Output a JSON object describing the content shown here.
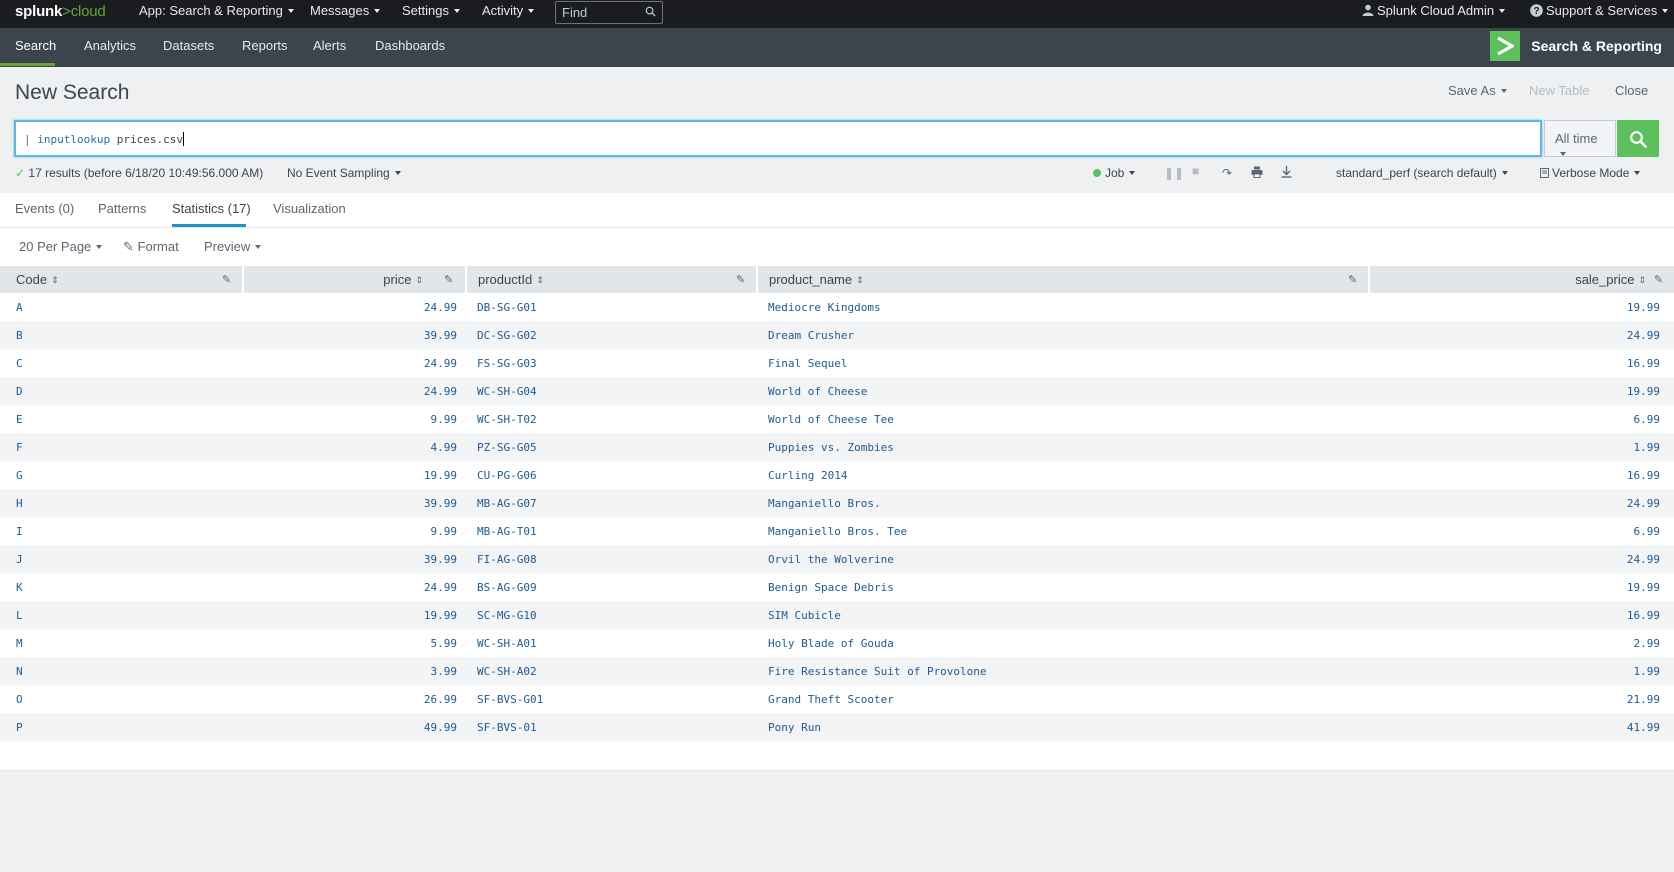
{
  "topbar": {
    "logo_main": "splunk",
    "logo_gt": ">",
    "logo_cloud": "cloud",
    "menus": [
      "App: Search & Reporting",
      "Messages",
      "Settings",
      "Activity"
    ],
    "find_placeholder": "Find",
    "user": "Splunk Cloud Admin",
    "support": "Support & Services"
  },
  "nav": {
    "items": [
      "Search",
      "Analytics",
      "Datasets",
      "Reports",
      "Alerts",
      "Dashboards"
    ],
    "active": "Search",
    "app_title": "Search & Reporting"
  },
  "page": {
    "title": "New Search",
    "save_as": "Save As",
    "new_table": "New Table",
    "close": "Close"
  },
  "search": {
    "pipe": "|",
    "command": "inputlookup",
    "argument": "prices.csv",
    "time_range": "All time"
  },
  "status": {
    "results": "17 results (before 6/18/20 10:49:56.000 AM)",
    "sampling": "No Event Sampling",
    "job": "Job",
    "perf": "standard_perf (search default)",
    "mode": "Verbose Mode"
  },
  "tabs": [
    "Events (0)",
    "Patterns",
    "Statistics (17)",
    "Visualization"
  ],
  "active_tab": "Statistics (17)",
  "toolbar": {
    "per_page": "20 Per Page",
    "format": "Format",
    "preview": "Preview"
  },
  "table": {
    "columns": [
      "Code",
      "price",
      "productId",
      "product_name",
      "sale_price"
    ],
    "rows": [
      [
        "A",
        "24.99",
        "DB-SG-G01",
        "Mediocre Kingdoms",
        "19.99"
      ],
      [
        "B",
        "39.99",
        "DC-SG-G02",
        "Dream Crusher",
        "24.99"
      ],
      [
        "C",
        "24.99",
        "FS-SG-G03",
        "Final Sequel",
        "16.99"
      ],
      [
        "D",
        "24.99",
        "WC-SH-G04",
        "World of Cheese",
        "19.99"
      ],
      [
        "E",
        "9.99",
        "WC-SH-T02",
        "World of Cheese Tee",
        "6.99"
      ],
      [
        "F",
        "4.99",
        "PZ-SG-G05",
        "Puppies vs. Zombies",
        "1.99"
      ],
      [
        "G",
        "19.99",
        "CU-PG-G06",
        "Curling 2014",
        "16.99"
      ],
      [
        "H",
        "39.99",
        "MB-AG-G07",
        "Manganiello Bros.",
        "24.99"
      ],
      [
        "I",
        "9.99",
        "MB-AG-T01",
        "Manganiello Bros. Tee",
        "6.99"
      ],
      [
        "J",
        "39.99",
        "FI-AG-G08",
        "Orvil the Wolverine",
        "24.99"
      ],
      [
        "K",
        "24.99",
        "BS-AG-G09",
        "Benign Space Debris",
        "19.99"
      ],
      [
        "L",
        "19.99",
        "SC-MG-G10",
        "SIM Cubicle",
        "16.99"
      ],
      [
        "M",
        "5.99",
        "WC-SH-A01",
        "Holy Blade of Gouda",
        "2.99"
      ],
      [
        "N",
        "3.99",
        "WC-SH-A02",
        "Fire Resistance Suit of Provolone",
        "1.99"
      ],
      [
        "O",
        "26.99",
        "SF-BVS-G01",
        "Grand Theft Scooter",
        "21.99"
      ],
      [
        "P",
        "49.99",
        "SF-BVS-01",
        "Pony Run",
        "41.99"
      ]
    ]
  }
}
